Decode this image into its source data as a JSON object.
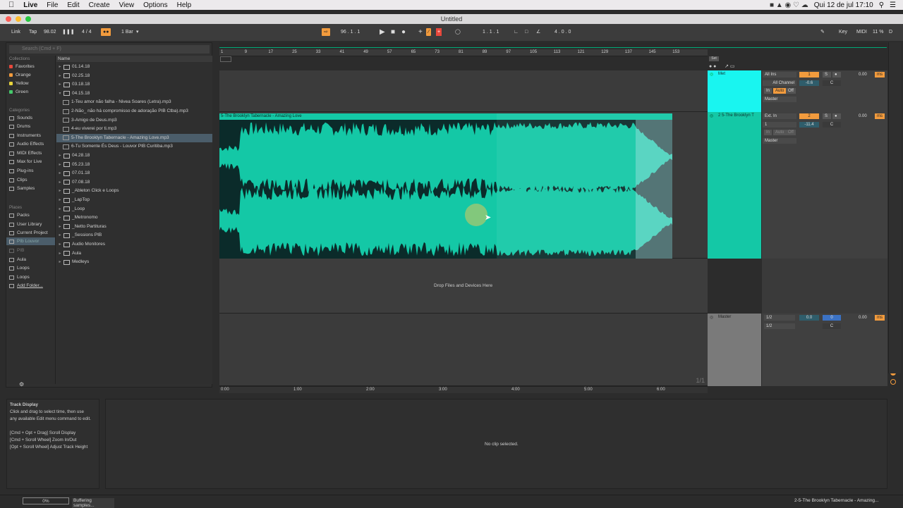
{
  "menubar": {
    "app": "Live",
    "items": [
      "File",
      "Edit",
      "Create",
      "View",
      "Options",
      "Help"
    ],
    "clock": "Qui 12 de jul  17:10"
  },
  "window": {
    "title": "Untitled"
  },
  "control_bar": {
    "link": "Link",
    "tap": "Tap",
    "tempo": "98.02",
    "meter": "4 / 4",
    "quantize": "1 Bar",
    "position": "96 .  1 .  1",
    "loop_start": "1 .  1 .  1",
    "loop_length": "4 .  0 .  0",
    "key": "Key",
    "midi": "MIDI",
    "cpu": "11 %",
    "d": "D"
  },
  "browser": {
    "search_placeholder": "Search (Cmd + F)",
    "collections_title": "Collections",
    "collections": [
      {
        "label": "Favorites",
        "color": "#e8483c"
      },
      {
        "label": "Orange",
        "color": "#f29b3d"
      },
      {
        "label": "Yellow",
        "color": "#e7d33c"
      },
      {
        "label": "Green",
        "color": "#45c96b"
      }
    ],
    "categories_title": "Categories",
    "categories": [
      "Sounds",
      "Drums",
      "Instruments",
      "Audio Effects",
      "MIDI Effects",
      "Max for Live",
      "Plug-ins",
      "Clips",
      "Samples"
    ],
    "places_title": "Places",
    "places": [
      "Packs",
      "User Library",
      "Current Project",
      "PIb Louvor",
      "PIB",
      "Aula",
      "Loops",
      "Loops",
      "Add Folder..."
    ],
    "name_header": "Name",
    "files": [
      {
        "label": "01.14.18",
        "type": "folder",
        "open": false
      },
      {
        "label": "02.25.18",
        "type": "folder",
        "open": false
      },
      {
        "label": "03.18.18",
        "type": "folder",
        "open": false
      },
      {
        "label": "04.15.18",
        "type": "folder",
        "open": true
      },
      {
        "label": "1-Teu amor não falha - Nivea Soares (Letra).mp3",
        "type": "audio"
      },
      {
        "label": "2-Não_ não há  compromisso de adoração PIB Ctba).mp3",
        "type": "audio"
      },
      {
        "label": "3-Amigo de Deus.mp3",
        "type": "audio"
      },
      {
        "label": "4-eu viverei por ti.mp3",
        "type": "audio"
      },
      {
        "label": "5-The Brooklyn Tabernacle - Amazing Love.mp3",
        "type": "audio",
        "selected": true
      },
      {
        "label": "6-Tu Somente És Deus - Louvor PIB Curitiba.mp3",
        "type": "audio"
      },
      {
        "label": "04.28.18",
        "type": "folder",
        "open": false
      },
      {
        "label": "05.23.18",
        "type": "folder",
        "open": false
      },
      {
        "label": "07.01.18",
        "type": "folder",
        "open": false
      },
      {
        "label": "07.08.18",
        "type": "folder",
        "open": false
      },
      {
        "label": "_Ableton Click e Loops",
        "type": "folder",
        "open": false
      },
      {
        "label": "_LapTop",
        "type": "folder",
        "open": false
      },
      {
        "label": "_Loop",
        "type": "folder",
        "open": false
      },
      {
        "label": "_Metronomo",
        "type": "folder",
        "open": false
      },
      {
        "label": "_Netto Partituras",
        "type": "folder",
        "open": false
      },
      {
        "label": "_Sessions PIB",
        "type": "folder",
        "open": false
      },
      {
        "label": "Audio Monitores",
        "type": "folder",
        "open": false
      },
      {
        "label": "Aula",
        "type": "folder",
        "open": false
      },
      {
        "label": "Medleys",
        "type": "folder",
        "open": false
      }
    ]
  },
  "arrangement": {
    "ruler_bars": [
      "1",
      "9",
      "17",
      "25",
      "33",
      "41",
      "49",
      "57",
      "65",
      "73",
      "81",
      "89",
      "97",
      "105",
      "113",
      "121",
      "129",
      "137",
      "145",
      "153"
    ],
    "time_marks": [
      "0:00",
      "1:00",
      "2:00",
      "3:00",
      "4:00",
      "5:00",
      "6:00"
    ],
    "set_label": "Set",
    "clip_name": "5-The Brooklyn Tabernacle - Amazing Love",
    "drop_hint": "Drop Files and Devices Here",
    "zoom_label": "1/1",
    "tracks": [
      {
        "name": "Met",
        "color": "#19f5f0",
        "input": "All Ins",
        "channel": "All Channel",
        "monitor": [
          "In",
          "Auto",
          "Off"
        ],
        "output": "Master",
        "number": "1",
        "volume": "-0.6",
        "pan": "C",
        "send": "0.00",
        "unit": "ms"
      },
      {
        "name": "2 5-The Brooklyn T",
        "color": "#14c8a6",
        "input": "Ext. In",
        "channel": "1",
        "monitor": [
          "In",
          "Auto",
          "Off"
        ],
        "output": "Master",
        "number": "2",
        "volume": "-11.4",
        "pan": "C",
        "send": "0.00",
        "unit": "ms"
      }
    ],
    "master": {
      "name": "Master",
      "input1": "1/2",
      "input2": "1/2",
      "volume": "0.0",
      "vol2": "0",
      "pan": "C",
      "send": "0.00",
      "unit": "ms"
    }
  },
  "info_view": {
    "title": "Track Display",
    "lines": [
      "Click and drag to select time, then use",
      "any available Edit menu command to edit.",
      "",
      "[Cmd + Opt + Drag] Scroll Display",
      "[Cmd + Scroll Wheel] Zoom In/Out",
      "[Opt + Scroll Wheel] Adjust Track Height"
    ]
  },
  "detail_view": {
    "empty_text": "No clip selected."
  },
  "status": {
    "progress_percent": 0,
    "progress_label": "0%",
    "buffer_text": "Buffering samples...",
    "current_clip": "2-5-The Brooklyn Tabernacle - Amazing..."
  },
  "colors": {
    "accent": "#f29b3d",
    "clip": "#14c8a6",
    "met": "#19f5f0",
    "selected": "#4b5d6a"
  }
}
